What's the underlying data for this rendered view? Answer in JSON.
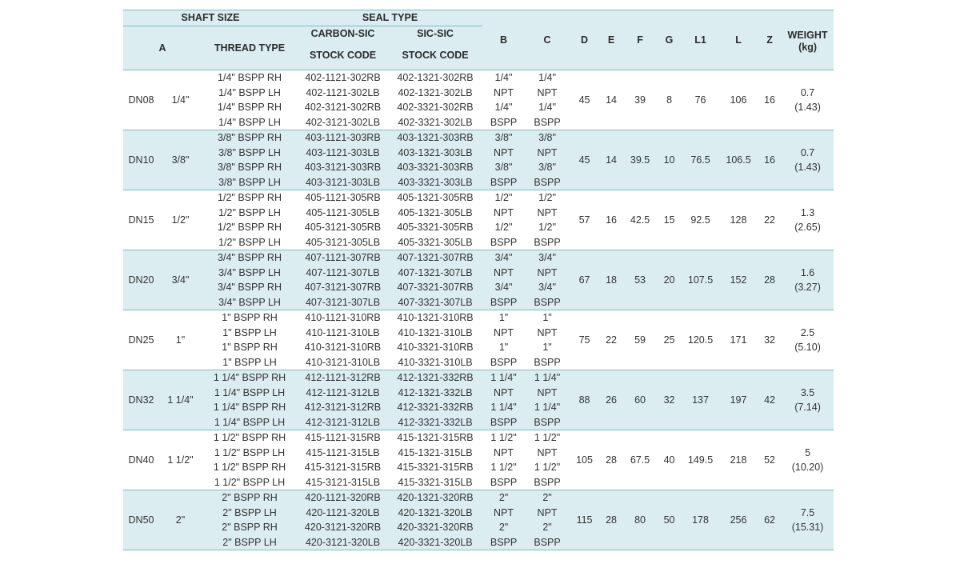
{
  "header": {
    "shaft_size": "SHAFT SIZE",
    "seal_type": "SEAL TYPE",
    "a": "A",
    "thread_type": "THREAD TYPE",
    "carbon_sic": "CARBON-SIC",
    "sic_sic": "SIC-SIC",
    "stock_code_1": "STOCK CODE",
    "stock_code_2": "STOCK CODE",
    "b": "B",
    "c": "C",
    "d": "D",
    "e": "E",
    "f": "F",
    "g": "G",
    "l1": "L1",
    "l": "L",
    "z": "Z",
    "weight": "WEIGHT",
    "weight_unit": "(kg)"
  },
  "groups": [
    {
      "dn": "DN08",
      "a": "1/4\"",
      "b1": "1/4\"",
      "b2": "NPT",
      "b3": "1/4\"",
      "b4": "BSPP",
      "c1": "1/4\"",
      "c2": "NPT",
      "c3": "1/4\"",
      "c4": "BSPP",
      "d": "45",
      "e": "14",
      "f": "39",
      "g": "8",
      "l1": "76",
      "l": "106",
      "z": "16",
      "w1": "0.7",
      "w2": "(1.43)",
      "rows": [
        {
          "thread": "1/4\" BSPP RH",
          "cs": "402-1121-302RB",
          "ss": "402-1321-302RB"
        },
        {
          "thread": "1/4\" BSPP LH",
          "cs": "402-1121-302LB",
          "ss": "402-1321-302LB"
        },
        {
          "thread": "1/4\" BSPP RH",
          "cs": "402-3121-302RB",
          "ss": "402-3321-302RB"
        },
        {
          "thread": "1/4\" BSPP LH",
          "cs": "402-3121-302LB",
          "ss": "402-3321-302LB"
        }
      ]
    },
    {
      "dn": "DN10",
      "a": "3/8\"",
      "b1": "3/8\"",
      "b2": "NPT",
      "b3": "3/8\"",
      "b4": "BSPP",
      "c1": "3/8\"",
      "c2": "NPT",
      "c3": "3/8\"",
      "c4": "BSPP",
      "d": "45",
      "e": "14",
      "f": "39.5",
      "g": "10",
      "l1": "76.5",
      "l": "106.5",
      "z": "16",
      "w1": "0.7",
      "w2": "(1.43)",
      "rows": [
        {
          "thread": "3/8\" BSPP RH",
          "cs": "403-1121-303RB",
          "ss": "403-1321-303RB"
        },
        {
          "thread": "3/8\" BSPP LH",
          "cs": "403-1121-303LB",
          "ss": "403-1321-303LB"
        },
        {
          "thread": "3/8\" BSPP RH",
          "cs": "403-3121-303RB",
          "ss": "403-3321-303RB"
        },
        {
          "thread": "3/8\" BSPP LH",
          "cs": "403-3121-303LB",
          "ss": "403-3321-303LB"
        }
      ]
    },
    {
      "dn": "DN15",
      "a": "1/2\"",
      "b1": "1/2\"",
      "b2": "NPT",
      "b3": "1/2\"",
      "b4": "BSPP",
      "c1": "1/2\"",
      "c2": "NPT",
      "c3": "1/2\"",
      "c4": "BSPP",
      "d": "57",
      "e": "16",
      "f": "42.5",
      "g": "15",
      "l1": "92.5",
      "l": "128",
      "z": "22",
      "w1": "1.3",
      "w2": "(2.65)",
      "rows": [
        {
          "thread": "1/2\" BSPP RH",
          "cs": "405-1121-305RB",
          "ss": "405-1321-305RB"
        },
        {
          "thread": "1/2\" BSPP LH",
          "cs": "405-1121-305LB",
          "ss": "405-1321-305LB"
        },
        {
          "thread": "1/2\" BSPP RH",
          "cs": "405-3121-305RB",
          "ss": "405-3321-305RB"
        },
        {
          "thread": "1/2\" BSPP LH",
          "cs": "405-3121-305LB",
          "ss": "405-3321-305LB"
        }
      ]
    },
    {
      "dn": "DN20",
      "a": "3/4\"",
      "b1": "3/4\"",
      "b2": "NPT",
      "b3": "3/4\"",
      "b4": "BSPP",
      "c1": "3/4\"",
      "c2": "NPT",
      "c3": "3/4\"",
      "c4": "BSPP",
      "d": "67",
      "e": "18",
      "f": "53",
      "g": "20",
      "l1": "107.5",
      "l": "152",
      "z": "28",
      "w1": "1.6",
      "w2": "(3.27)",
      "rows": [
        {
          "thread": "3/4\" BSPP RH",
          "cs": "407-1121-307RB",
          "ss": "407-1321-307RB"
        },
        {
          "thread": "3/4\" BSPP LH",
          "cs": "407-1121-307LB",
          "ss": "407-1321-307LB"
        },
        {
          "thread": "3/4\" BSPP RH",
          "cs": "407-3121-307RB",
          "ss": "407-3321-307RB"
        },
        {
          "thread": "3/4\" BSPP LH",
          "cs": "407-3121-307LB",
          "ss": "407-3321-307LB"
        }
      ]
    },
    {
      "dn": "DN25",
      "a": "1\"",
      "b1": "1\"",
      "b2": "NPT",
      "b3": "1\"",
      "b4": "BSPP",
      "c1": "1\"",
      "c2": "NPT",
      "c3": "1\"",
      "c4": "BSPP",
      "d": "75",
      "e": "22",
      "f": "59",
      "g": "25",
      "l1": "120.5",
      "l": "171",
      "z": "32",
      "w1": "2.5",
      "w2": "(5.10)",
      "rows": [
        {
          "thread": "1\" BSPP RH",
          "cs": "410-1121-310RB",
          "ss": "410-1321-310RB"
        },
        {
          "thread": "1\" BSPP LH",
          "cs": "410-1121-310LB",
          "ss": "410-1321-310LB"
        },
        {
          "thread": "1\" BSPP RH",
          "cs": "410-3121-310RB",
          "ss": "410-3321-310RB"
        },
        {
          "thread": "1\" BSPP LH",
          "cs": "410-3121-310LB",
          "ss": "410-3321-310LB"
        }
      ]
    },
    {
      "dn": "DN32",
      "a": "1 1/4\"",
      "b1": "1 1/4\"",
      "b2": "NPT",
      "b3": "1 1/4\"",
      "b4": "BSPP",
      "c1": "1 1/4\"",
      "c2": "NPT",
      "c3": "1 1/4\"",
      "c4": "BSPP",
      "d": "88",
      "e": "26",
      "f": "60",
      "g": "32",
      "l1": "137",
      "l": "197",
      "z": "42",
      "w1": "3.5",
      "w2": "(7.14)",
      "rows": [
        {
          "thread": "1 1/4\" BSPP RH",
          "cs": "412-1121-312RB",
          "ss": "412-1321-332RB"
        },
        {
          "thread": "1 1/4\" BSPP LH",
          "cs": "412-1121-312LB",
          "ss": "412-1321-332LB"
        },
        {
          "thread": "1 1/4\" BSPP RH",
          "cs": "412-3121-312RB",
          "ss": "412-3321-332RB"
        },
        {
          "thread": "1 1/4\" BSPP LH",
          "cs": "412-3121-312LB",
          "ss": "412-3321-332LB"
        }
      ]
    },
    {
      "dn": "DN40",
      "a": "1 1/2\"",
      "b1": "1 1/2\"",
      "b2": "NPT",
      "b3": "1 1/2\"",
      "b4": "BSPP",
      "c1": "1 1/2\"",
      "c2": "NPT",
      "c3": "1 1/2\"",
      "c4": "BSPP",
      "d": "105",
      "e": "28",
      "f": "67.5",
      "g": "40",
      "l1": "149.5",
      "l": "218",
      "z": "52",
      "w1": "5",
      "w2": "(10.20)",
      "rows": [
        {
          "thread": "1 1/2\" BSPP RH",
          "cs": "415-1121-315RB",
          "ss": "415-1321-315RB"
        },
        {
          "thread": "1 1/2\" BSPP LH",
          "cs": "415-1121-315LB",
          "ss": "415-1321-315LB"
        },
        {
          "thread": "1 1/2\" BSPP RH",
          "cs": "415-3121-315RB",
          "ss": "415-3321-315RB"
        },
        {
          "thread": "1 1/2\" BSPP LH",
          "cs": "415-3121-315LB",
          "ss": "415-3321-315LB"
        }
      ]
    },
    {
      "dn": "DN50",
      "a": "2\"",
      "b1": "2\"",
      "b2": "NPT",
      "b3": "2\"",
      "b4": "BSPP",
      "c1": "2\"",
      "c2": "NPT",
      "c3": "2\"",
      "c4": "BSPP",
      "d": "115",
      "e": "28",
      "f": "80",
      "g": "50",
      "l1": "178",
      "l": "256",
      "z": "62",
      "w1": "7.5",
      "w2": "(15.31)",
      "rows": [
        {
          "thread": "2\" BSPP RH",
          "cs": "420-1121-320RB",
          "ss": "420-1321-320RB"
        },
        {
          "thread": "2\" BSPP LH",
          "cs": "420-1121-320LB",
          "ss": "420-1321-320LB"
        },
        {
          "thread": "2\" BSPP RH",
          "cs": "420-3121-320RB",
          "ss": "420-3321-320RB"
        },
        {
          "thread": "2\" BSPP LH",
          "cs": "420-3121-320LB",
          "ss": "420-3321-320LB"
        }
      ]
    }
  ],
  "colors": {
    "header_fill": "#dcedf2",
    "row_fill": "#dcedf2",
    "rule": "#7fb8c9"
  }
}
